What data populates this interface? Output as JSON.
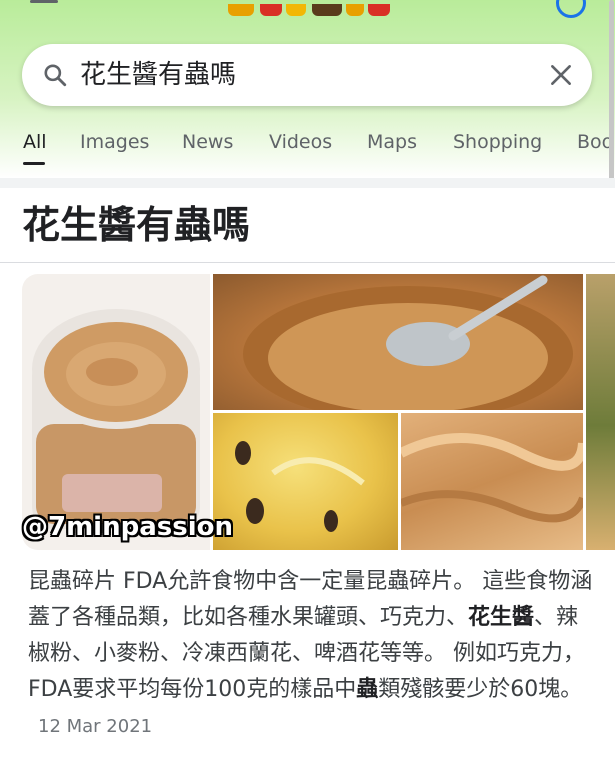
{
  "search": {
    "query": "花生醬有蟲嗎"
  },
  "tabs": [
    {
      "label": "All",
      "active": true
    },
    {
      "label": "Images"
    },
    {
      "label": "News"
    },
    {
      "label": "Videos"
    },
    {
      "label": "Maps"
    },
    {
      "label": "Shopping"
    },
    {
      "label": "Boo"
    }
  ],
  "result": {
    "title": "花生醬有蟲嗎",
    "watermark": "@7minpassion",
    "snippet": {
      "part1": "昆蟲碎片 FDA允許食物中含一定量昆蟲碎片。 這些食物涵蓋了各種品類，比如各種水果罐頭、巧克力、",
      "bold1": "花生醬",
      "part2": "、辣椒粉、小麥粉、冷凍西蘭花、啤酒花等等。 例如巧克力，FDA要求平均每份100克的樣品中",
      "bold2": "蟲",
      "part3": "類殘骸要少於60塊。",
      "date": "12 Mar 2021"
    }
  },
  "colors": {
    "header_background": "#c8efb0",
    "accent": "#1a73e8"
  },
  "icons": [
    "menu-icon",
    "search-icon",
    "clear-icon",
    "account-icon"
  ]
}
